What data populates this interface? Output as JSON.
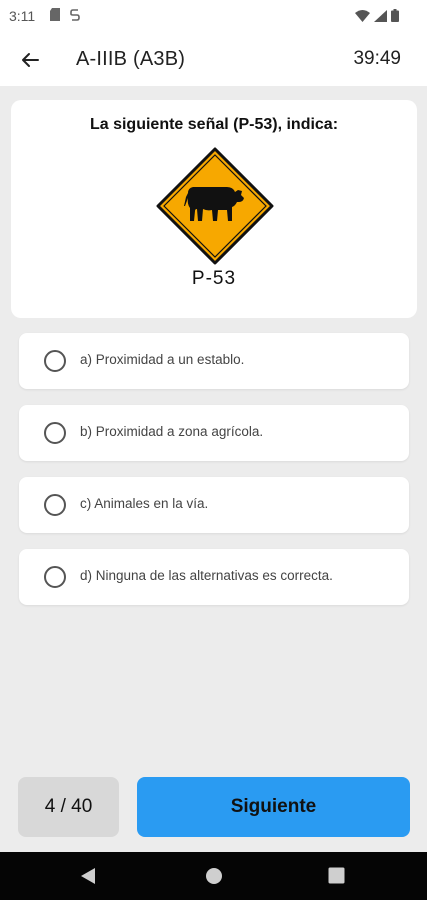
{
  "status_bar": {
    "time": "3:11",
    "icons": [
      "sd-card-icon",
      "sync-icon",
      "wifi-icon",
      "signal-icon",
      "battery-icon"
    ]
  },
  "app_bar": {
    "back_icon": "arrow-left-icon",
    "title": "A-IIIB (A3B)",
    "timer": "39:49"
  },
  "question": {
    "text": "La siguiente señal (P-53), indica:",
    "sign_code": "P-53",
    "sign_icon": "cattle-crossing-sign",
    "sign_color": "#F7A800"
  },
  "options": [
    {
      "label": "a) Proximidad a un establo."
    },
    {
      "label": "b) Proximidad a zona agrícola."
    },
    {
      "label": "c) Animales en la vía."
    },
    {
      "label": "d) Ninguna de las alternativas es correcta."
    }
  ],
  "footer": {
    "counter": "4 / 40",
    "next_label": "Siguiente",
    "accent": "#2A9BF2"
  },
  "nav_bar": {
    "icons": [
      "back-triangle-icon",
      "home-circle-icon",
      "recent-square-icon"
    ]
  }
}
